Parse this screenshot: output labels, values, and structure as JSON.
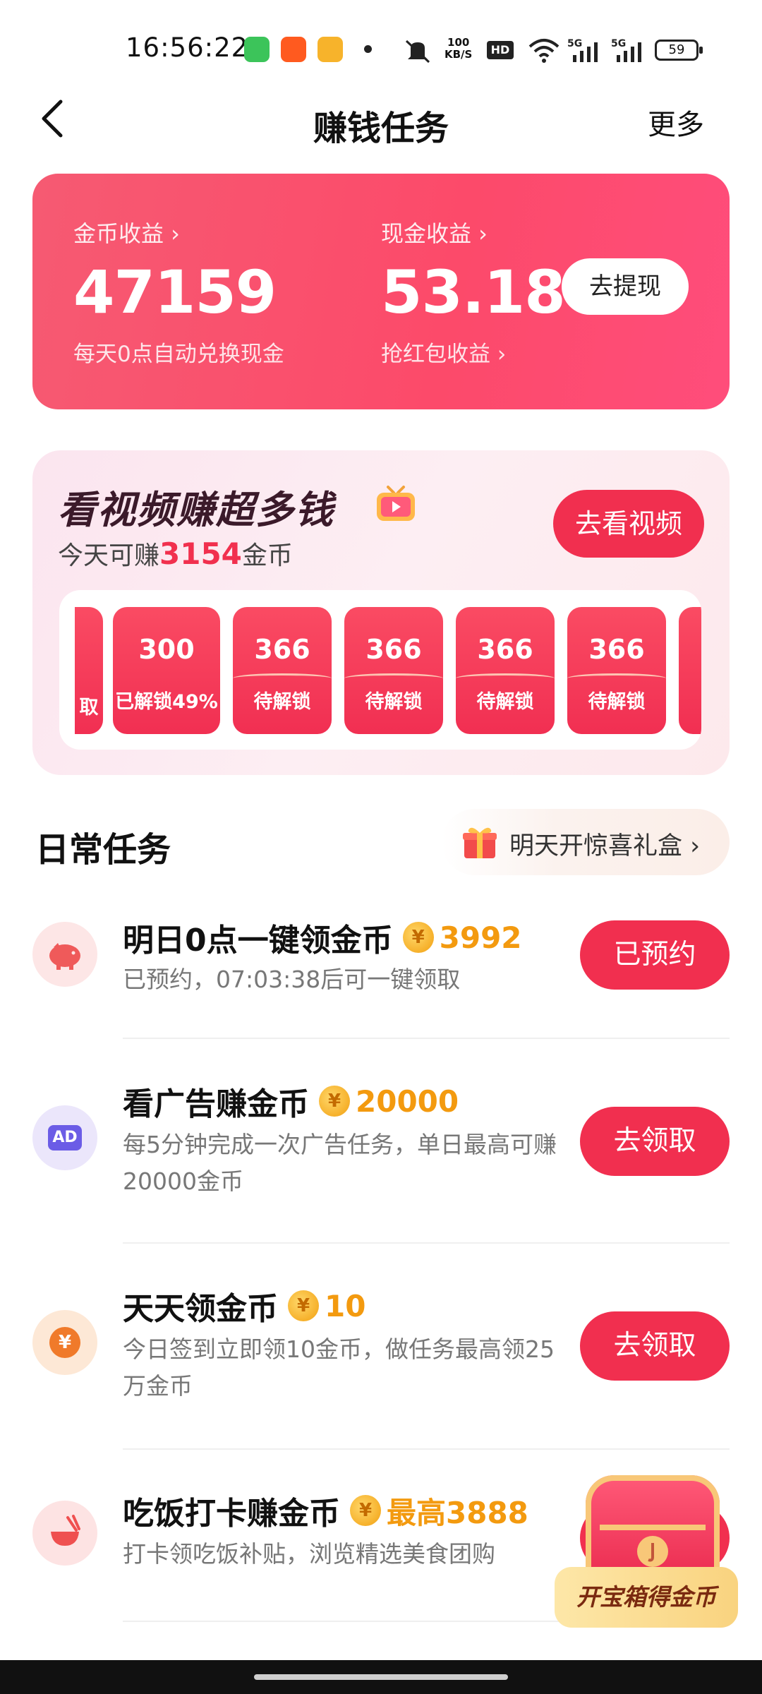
{
  "status_bar": {
    "time": "16:56:22",
    "speed_top": "100",
    "speed_bottom": "KB/S",
    "hd": "HD",
    "battery": "59",
    "icons": [
      "message-app-icon",
      "taobao-app-icon",
      "video-app-icon",
      "mute-icon",
      "wifi-icon",
      "signal-5g-icon",
      "signal-5g-icon"
    ]
  },
  "nav": {
    "title": "赚钱任务",
    "more": "更多"
  },
  "earnings": {
    "coin_label": "金币收益 ›",
    "coin_value": "47159",
    "coin_sub": "每天0点自动兑换现金",
    "cash_label": "现金收益 ›",
    "cash_value": "53.18",
    "cash_sub": "抢红包收益 ›",
    "withdraw_button": "去提现"
  },
  "video_card": {
    "title": "看视频赚超多钱",
    "sub_prefix": "今天可赚",
    "sub_amount": "3154",
    "sub_suffix": "金币",
    "watch_button": "去看视频",
    "partial_slot_text": "取",
    "slots": [
      {
        "amount": "300",
        "status": "已解锁49%"
      },
      {
        "amount": "366",
        "status": "待解锁"
      },
      {
        "amount": "366",
        "status": "待解锁"
      },
      {
        "amount": "366",
        "status": "待解锁"
      },
      {
        "amount": "366",
        "status": "待解锁"
      }
    ]
  },
  "daily": {
    "title": "日常任务",
    "gift_text": "明天开惊喜礼盒 ›"
  },
  "tasks": [
    {
      "name": "明日0点一键领金币",
      "coin": "¥",
      "reward": "3992",
      "desc": "已预约，07:03:38后可一键领取",
      "button": "已预约",
      "icon": "piggy-bank-icon",
      "icon_text": ""
    },
    {
      "name": "看广告赚金币",
      "coin": "¥",
      "reward": "20000",
      "desc": "每5分钟完成一次广告任务，单日最高可赚20000金币",
      "button": "去领取",
      "icon": "ad-icon",
      "icon_text": "AD"
    },
    {
      "name": "天天领金币",
      "coin": "¥",
      "reward": "10",
      "desc": "今日签到立即领10金币，做任务最高领25万金币",
      "button": "去领取",
      "icon": "yuan-coin-icon",
      "icon_text": "¥"
    },
    {
      "name": "吃饭打卡赚金币",
      "coin": "¥",
      "reward": "最高3888",
      "desc": "打卡领吃饭补贴，浏览精选美食团购",
      "button": "",
      "icon": "rice-bowl-icon",
      "icon_text": ""
    }
  ],
  "treasure": {
    "label": "开宝箱得金币"
  },
  "colors": {
    "primary_red": "#f12f4f",
    "reward_orange": "#f39a0f"
  }
}
